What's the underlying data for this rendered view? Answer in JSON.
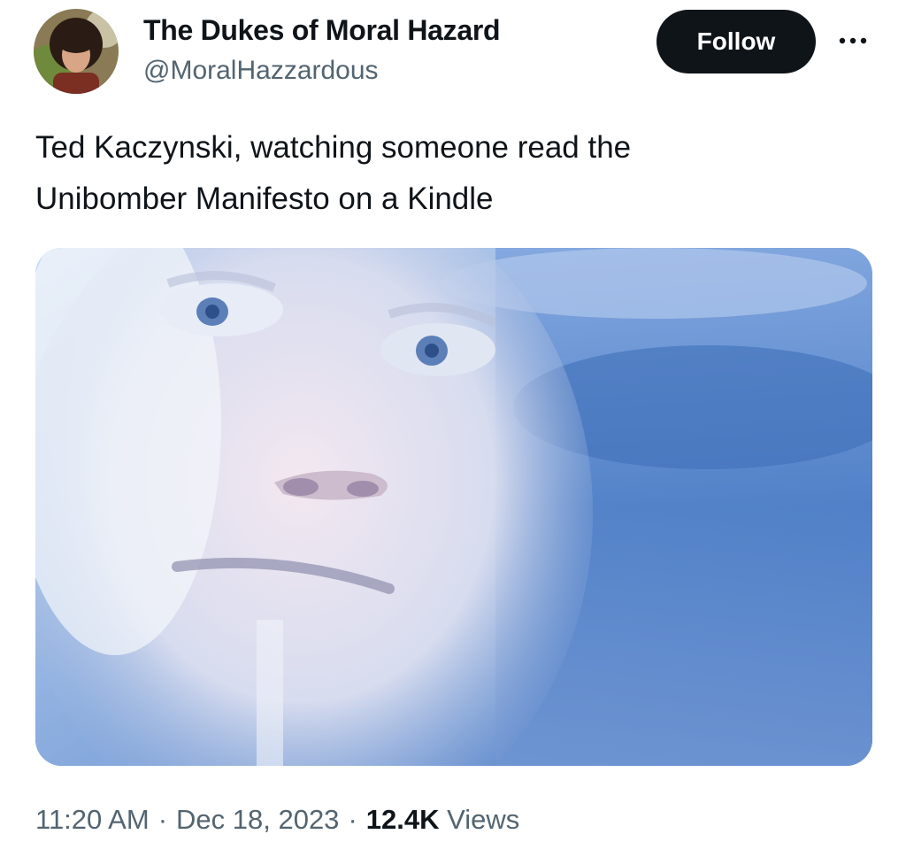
{
  "author": {
    "display_name": "The Dukes of Moral Hazard",
    "handle": "@MoralHazzardous"
  },
  "actions": {
    "follow_label": "Follow",
    "more_icon": "more-horizontal-icon"
  },
  "tweet": {
    "text": "Ted Kaczynski, watching someone read the\nUnibomber Manifesto on a Kindle"
  },
  "meta": {
    "time": "11:20 AM",
    "separator": "·",
    "date": "Dec 18, 2023",
    "views_count": "12.4K",
    "views_label": "Views"
  },
  "colors": {
    "text_primary": "#0f1419",
    "text_secondary": "#536471",
    "follow_bg": "#0f1419",
    "follow_text": "#ffffff",
    "media_tint": "#5c84c4"
  }
}
